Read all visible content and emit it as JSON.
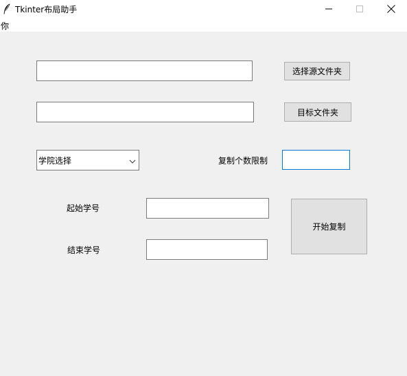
{
  "window": {
    "title": "Tkinter布局助手",
    "icon": "feather-icon",
    "controls": [
      "minimize-icon",
      "maximize-icon",
      "close-icon"
    ]
  },
  "menubar": {
    "items": [
      {
        "label": "你"
      }
    ]
  },
  "form": {
    "source_path": {
      "value": "",
      "placeholder": ""
    },
    "select_source_button": "选择源文件夹",
    "target_path": {
      "value": "",
      "placeholder": ""
    },
    "target_folder_button": "目标文件夹",
    "college_select": {
      "selected": "学院选择",
      "icon": "chevron-down-icon"
    },
    "copy_limit_label": "复制个数限制",
    "copy_limit": {
      "value": ""
    },
    "start_id_label": "起始学号",
    "start_id": {
      "value": ""
    },
    "end_id_label": "结束学号",
    "end_id": {
      "value": ""
    },
    "start_copy_button": "开始复制"
  }
}
